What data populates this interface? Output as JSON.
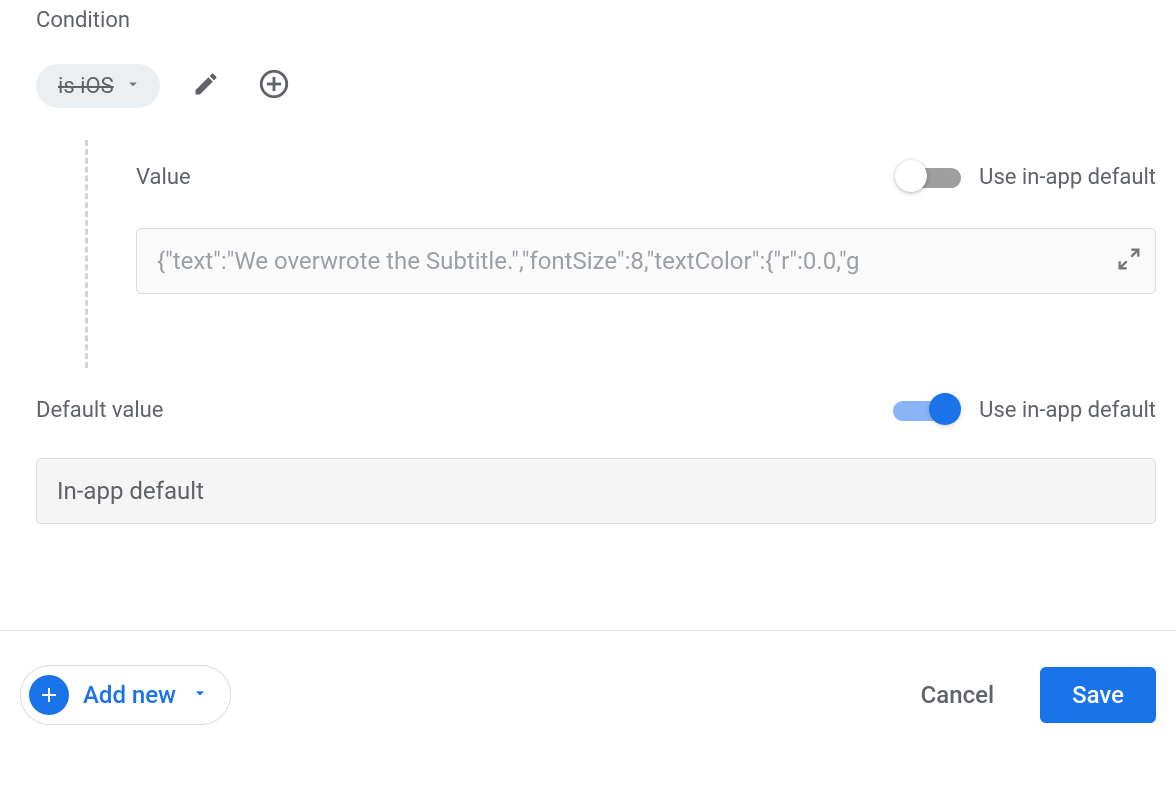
{
  "condition": {
    "label": "Condition",
    "chip": "is iOS"
  },
  "value": {
    "label": "Value",
    "toggle_label": "Use in-app default",
    "input": "{\"text\":\"We overwrote the Subtitle.\",\"fontSize\":8,\"textColor\":{\"r\":0.0,\"g"
  },
  "default": {
    "label": "Default value",
    "toggle_label": "Use in-app default",
    "input": "In-app default"
  },
  "footer": {
    "add_new": "Add new",
    "cancel": "Cancel",
    "save": "Save"
  }
}
